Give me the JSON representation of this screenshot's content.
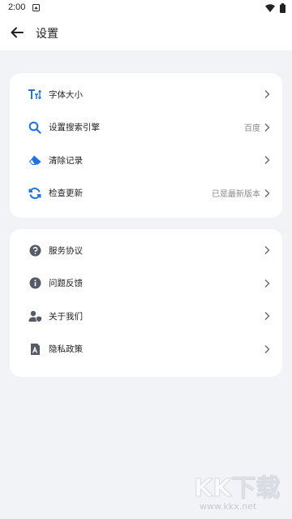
{
  "status": {
    "time": "2:00"
  },
  "appbar": {
    "title": "设置"
  },
  "group1": [
    {
      "label": "字体大小",
      "value": "",
      "icon": "font-size-icon",
      "color": "#1a73e8"
    },
    {
      "label": "设置搜索引擎",
      "value": "百度",
      "icon": "search-icon",
      "color": "#1a73e8"
    },
    {
      "label": "清除记录",
      "value": "",
      "icon": "eraser-icon",
      "color": "#1a73e8"
    },
    {
      "label": "检查更新",
      "value": "已是最新版本",
      "icon": "refresh-icon",
      "color": "#1a73e8"
    }
  ],
  "group2": [
    {
      "label": "服务协议",
      "icon": "help-circle-icon",
      "color": "#555a66"
    },
    {
      "label": "问题反馈",
      "icon": "info-circle-icon",
      "color": "#555a66"
    },
    {
      "label": "关于我们",
      "icon": "user-shield-icon",
      "color": "#555a66"
    },
    {
      "label": "隐私政策",
      "icon": "document-icon",
      "color": "#555a66"
    }
  ],
  "watermark": {
    "logo_text": "KK下载",
    "url": "www.kkx.net"
  }
}
